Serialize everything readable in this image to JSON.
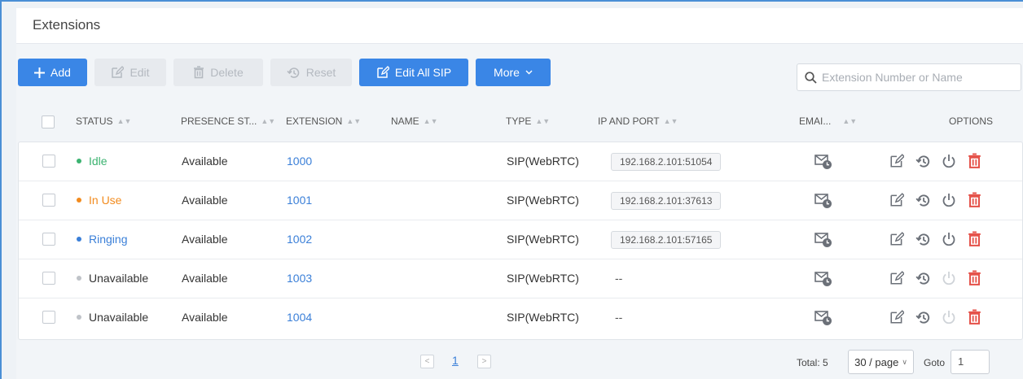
{
  "page": {
    "title": "Extensions"
  },
  "toolbar": {
    "add": "Add",
    "edit": "Edit",
    "delete": "Delete",
    "reset": "Reset",
    "edit_all_sip": "Edit All SIP",
    "more": "More"
  },
  "search": {
    "placeholder": "Extension Number or Name"
  },
  "columns": {
    "status": "STATUS",
    "presence": "PRESENCE ST...",
    "extension": "EXTENSION",
    "name": "NAME",
    "type": "TYPE",
    "ip_port": "IP AND PORT",
    "email": "EMAI...",
    "options": "OPTIONS"
  },
  "rows": [
    {
      "status": "Idle",
      "status_color": "#3cb371",
      "presence": "Available",
      "extension": "1000",
      "name": "",
      "type": "SIP(WebRTC)",
      "ip_port": "192.168.2.101:51054",
      "reboot_enabled": true
    },
    {
      "status": "In Use",
      "status_color": "#f28b1e",
      "presence": "Available",
      "extension": "1001",
      "name": "",
      "type": "SIP(WebRTC)",
      "ip_port": "192.168.2.101:37613",
      "reboot_enabled": true
    },
    {
      "status": "Ringing",
      "status_color": "#3a7fd8",
      "presence": "Available",
      "extension": "1002",
      "name": "",
      "type": "SIP(WebRTC)",
      "ip_port": "192.168.2.101:57165",
      "reboot_enabled": true
    },
    {
      "status": "Unavailable",
      "status_color": "#bfc3c8",
      "presence": "Available",
      "extension": "1003",
      "name": "",
      "type": "SIP(WebRTC)",
      "ip_port": "--",
      "reboot_enabled": false
    },
    {
      "status": "Unavailable",
      "status_color": "#bfc3c8",
      "presence": "Available",
      "extension": "1004",
      "name": "",
      "type": "SIP(WebRTC)",
      "ip_port": "--",
      "reboot_enabled": false
    }
  ],
  "pagination": {
    "current_page": "1",
    "total": "Total: 5",
    "per_page": "30 / page",
    "goto_label": "Goto",
    "goto_value": "1"
  },
  "colors": {
    "primary": "#3a86e6",
    "link": "#3a7fd8",
    "delete_red": "#e5534b",
    "icon_gray": "#6b7078",
    "disabled_icon": "#cfd3d8"
  },
  "icons": {
    "add": "plus-icon",
    "edit": "edit-icon",
    "delete": "trash-icon",
    "reset": "history-icon",
    "more": "chevron-down-icon",
    "search": "search-icon",
    "email": "email-clock-icon",
    "reboot": "power-icon"
  }
}
